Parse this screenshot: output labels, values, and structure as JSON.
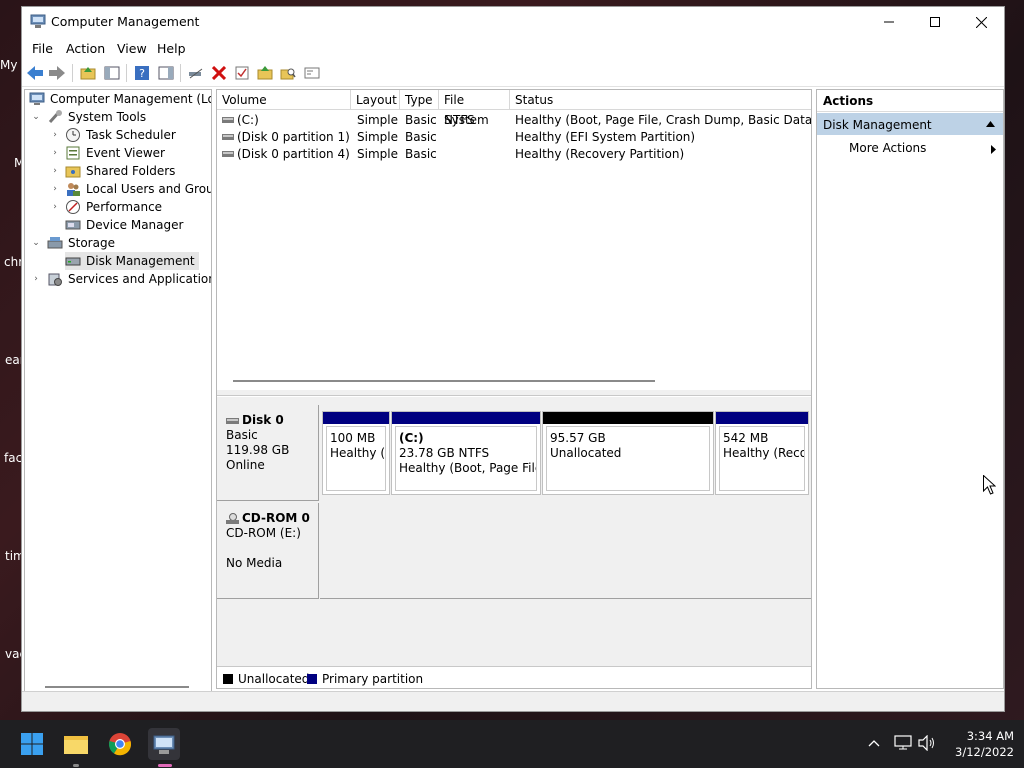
{
  "desktop": {
    "labels": [
      "My",
      "M",
      "chr",
      "ear",
      "fac",
      "tim",
      "vac"
    ]
  },
  "window": {
    "title": "Computer Management",
    "menu": [
      "File",
      "Action",
      "View",
      "Help"
    ]
  },
  "tree": {
    "root": "Computer Management (Local",
    "system_tools": "System Tools",
    "task_scheduler": "Task Scheduler",
    "event_viewer": "Event Viewer",
    "shared_folders": "Shared Folders",
    "local_users": "Local Users and Groups",
    "performance": "Performance",
    "device_manager": "Device Manager",
    "storage": "Storage",
    "disk_management": "Disk Management",
    "services": "Services and Applications"
  },
  "volumes": {
    "columns": [
      "Volume",
      "Layout",
      "Type",
      "File System",
      "Status"
    ],
    "rows": [
      {
        "volume": "(C:)",
        "layout": "Simple",
        "type": "Basic",
        "fs": "NTFS",
        "status": "Healthy (Boot, Page File, Crash Dump, Basic Data Partiti"
      },
      {
        "volume": "(Disk 0 partition 1)",
        "layout": "Simple",
        "type": "Basic",
        "fs": "",
        "status": "Healthy (EFI System Partition)"
      },
      {
        "volume": "(Disk 0 partition 4)",
        "layout": "Simple",
        "type": "Basic",
        "fs": "",
        "status": "Healthy (Recovery Partition)"
      }
    ]
  },
  "disks": {
    "disk0": {
      "name": "Disk 0",
      "kind": "Basic",
      "size": "119.98 GB",
      "state": "Online",
      "partitions": [
        {
          "line1": "100 MB",
          "line2": "Healthy (E"
        },
        {
          "name": "(C:)",
          "line1": "23.78 GB NTFS",
          "line2": "Healthy (Boot, Page File, C"
        },
        {
          "line1": "95.57 GB",
          "line2": "Unallocated"
        },
        {
          "line1": "542 MB",
          "line2": "Healthy (Recov"
        }
      ]
    },
    "cdrom": {
      "name": "CD-ROM 0",
      "kind": "CD-ROM (E:)",
      "state": "No Media"
    }
  },
  "legend": {
    "unallocated": "Unallocated",
    "primary": "Primary partition"
  },
  "colors": {
    "primary": "#000080",
    "unallocated": "#000000",
    "selection": "#bdd2e6"
  },
  "actions": {
    "header": "Actions",
    "section": "Disk Management",
    "more": "More Actions"
  },
  "taskbar": {
    "time": "3:34 AM",
    "date": "3/12/2022"
  }
}
